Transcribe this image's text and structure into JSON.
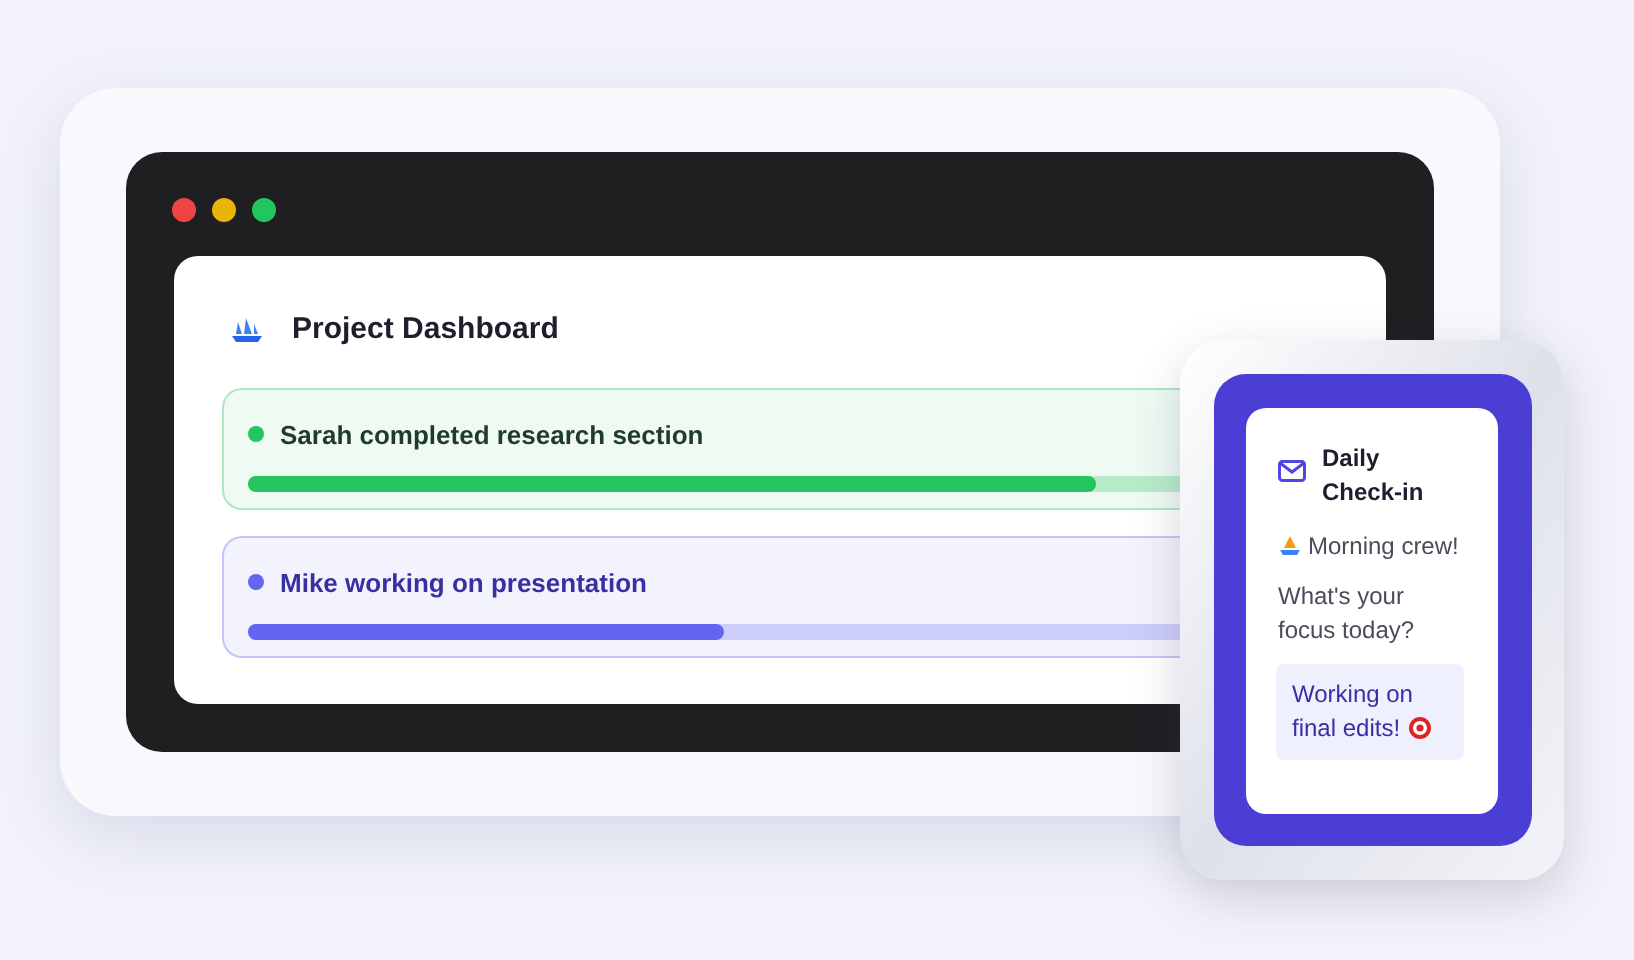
{
  "dashboard": {
    "title": "Project Dashboard",
    "window_controls": [
      {
        "color": "#ef4444"
      },
      {
        "color": "#eab308"
      },
      {
        "color": "#22c55e"
      }
    ],
    "activities": [
      {
        "text": "Sarah completed research section",
        "color": "#22c55e",
        "level": 0.91
      },
      {
        "text": "Mike working on presentation",
        "color": "#6366f1",
        "level": 0.51
      }
    ]
  },
  "checkin": {
    "title": "Daily Check-in",
    "greeting": "Morning crew!",
    "question": "What's your focus today?",
    "reply": "Working on final edits!"
  }
}
